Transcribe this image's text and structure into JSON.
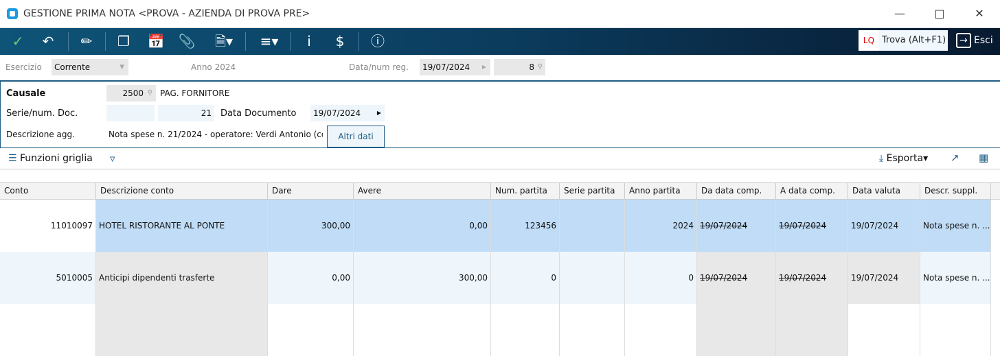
{
  "window": {
    "title": "GESTIONE PRIMA NOTA <PROVA - AZIENDA DI PROVA PRE>"
  },
  "toolbar": {
    "lq": "LQ",
    "search_placeholder": "Trova (Alt+F1)",
    "exit_label": "Esci"
  },
  "header": {
    "esercizio_label": "Esercizio",
    "esercizio_value": "Corrente",
    "anno": "Anno 2024",
    "data_label": "Data/num reg.",
    "data_value": "19/07/2024",
    "num_value": "8"
  },
  "form": {
    "causale_label": "Causale",
    "causale_code": "2500",
    "causale_desc": "PAG. FORNITORE",
    "serie_label": "Serie/num. Doc.",
    "serie_value": "",
    "num_doc": "21",
    "data_doc_label": "Data Documento",
    "data_doc_value": "19/07/2024",
    "descr_label": "Descrizione agg.",
    "descr_value": "Nota spese n. 21/2024 - operatore: Verdi Antonio (coc",
    "altri_dati": "Altri dati"
  },
  "gridbar": {
    "funzioni": "Funzioni griglia",
    "esporta": "Esporta"
  },
  "columns": [
    "Conto",
    "Descrizione conto",
    "Dare",
    "Avere",
    "Num. partita",
    "Serie partita",
    "Anno partita",
    "Da data comp.",
    "A data comp.",
    "Data valuta",
    "Descr. suppl."
  ],
  "rows": [
    {
      "conto": "11010097",
      "descr": "HOTEL RISTORANTE AL PONTE",
      "dare": "300,00",
      "avere": "0,00",
      "num_partita": "123456",
      "serie": "",
      "anno": "2024",
      "da_data": "19/07/2024",
      "a_data": "19/07/2024",
      "valuta": "19/07/2024",
      "suppl": "Nota spese n. ..."
    },
    {
      "conto": "5010005",
      "descr": "Anticipi dipendenti trasferte",
      "dare": "0,00",
      "avere": "300,00",
      "num_partita": "0",
      "serie": "",
      "anno": "0",
      "da_data": "19/07/2024",
      "a_data": "19/07/2024",
      "valuta": "19/07/2024",
      "suppl": "Nota spese n. ..."
    }
  ]
}
